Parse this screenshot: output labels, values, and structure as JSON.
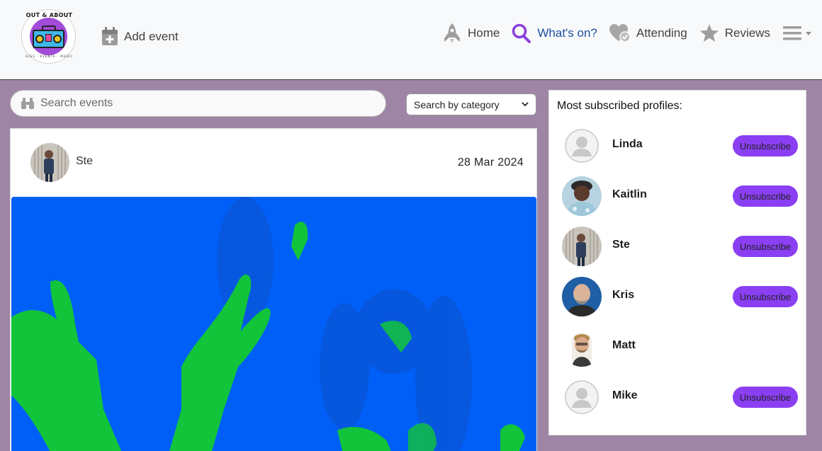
{
  "logo": {
    "text_top": "OUT & ABOUT",
    "text_bottom": "GIGS · EVENTS · MUSIC"
  },
  "nav": {
    "add_event": "Add event",
    "items": [
      {
        "label": "Home",
        "icon": "rocket-icon"
      },
      {
        "label": "What's on?",
        "icon": "search-icon",
        "active": true
      },
      {
        "label": "Attending",
        "icon": "heart-check-icon"
      },
      {
        "label": "Reviews",
        "icon": "star-icon"
      }
    ],
    "menu_icon": "hamburger-menu-icon"
  },
  "search": {
    "placeholder": "Search events"
  },
  "category": {
    "selected": "Search by category"
  },
  "event": {
    "author": "Ste",
    "date": "28 Mar 2024"
  },
  "profiles": {
    "title": "Most subscribed profiles:",
    "items": [
      {
        "name": "Linda",
        "button": "Unsubscribe"
      },
      {
        "name": "Kaitlin",
        "button": "Unsubscribe"
      },
      {
        "name": "Ste",
        "button": "Unsubscribe"
      },
      {
        "name": "Kris",
        "button": "Unsubscribe"
      },
      {
        "name": "Matt",
        "button": ""
      },
      {
        "name": "Mike",
        "button": "Unsubscribe"
      }
    ]
  },
  "colors": {
    "brand_purple": "#8a3ff2",
    "page_background": "#9e85a6",
    "active_nav": "#1d4fa1",
    "event_image_blue": "#005ff7",
    "event_image_green": "#12c43a"
  }
}
